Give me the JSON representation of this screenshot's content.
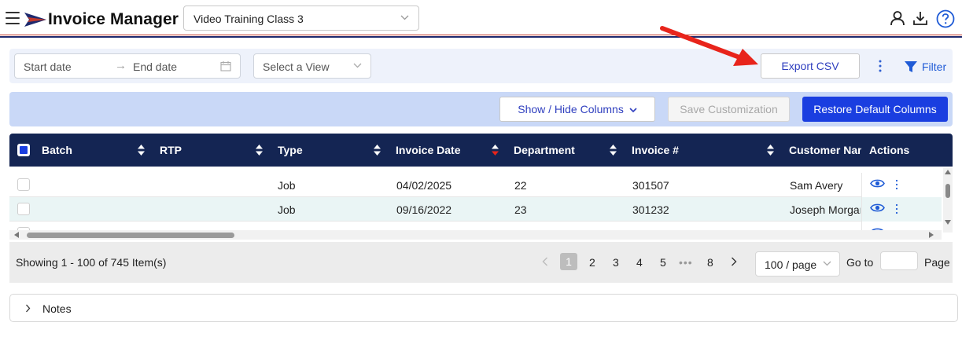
{
  "app": {
    "title": "Invoice Manager",
    "selected_class": "Video Training Class 3",
    "brand_colors": {
      "navy": "#142553",
      "accent_blue": "#1a3ee0",
      "stripe_red": "#c0392b"
    }
  },
  "header": {
    "icons": [
      "menu-icon",
      "user-icon",
      "download-icon",
      "help-icon"
    ]
  },
  "filters": {
    "start_date_placeholder": "Start date",
    "end_date_placeholder": "End date",
    "range_separator": "→",
    "view_placeholder": "Select a View",
    "export_label": "Export CSV",
    "filter_label": "Filter"
  },
  "column_bar": {
    "show_hide_label": "Show / Hide Columns",
    "save_label": "Save Customization",
    "restore_label": "Restore Default Columns"
  },
  "table": {
    "columns": [
      {
        "key": "batch",
        "label": "Batch"
      },
      {
        "key": "rtp",
        "label": "RTP"
      },
      {
        "key": "type",
        "label": "Type"
      },
      {
        "key": "invoice_date",
        "label": "Invoice Date"
      },
      {
        "key": "department",
        "label": "Department"
      },
      {
        "key": "invoice_no",
        "label": "Invoice #"
      },
      {
        "key": "customer",
        "label": "Customer Name"
      },
      {
        "key": "actions",
        "label": "Actions"
      }
    ],
    "rows": [
      {
        "batch": "",
        "rtp": "",
        "type": "Job",
        "invoice_date": "04/02/2025",
        "department": "22",
        "invoice_no": "301507",
        "customer": "Sam Avery"
      },
      {
        "batch": "",
        "rtp": "",
        "type": "Job",
        "invoice_date": "09/16/2022",
        "department": "23",
        "invoice_no": "301232",
        "customer": "Joseph Morgan"
      }
    ]
  },
  "pagination": {
    "showing": "Showing 1 - 100 of 745 Item(s)",
    "pages": [
      "1",
      "2",
      "3",
      "4",
      "5",
      "8"
    ],
    "current_page": "1",
    "ellipsis": "•••",
    "per_page": "100 / page",
    "goto_label": "Go to",
    "page_label": "Page"
  },
  "notes": {
    "label": "Notes"
  }
}
